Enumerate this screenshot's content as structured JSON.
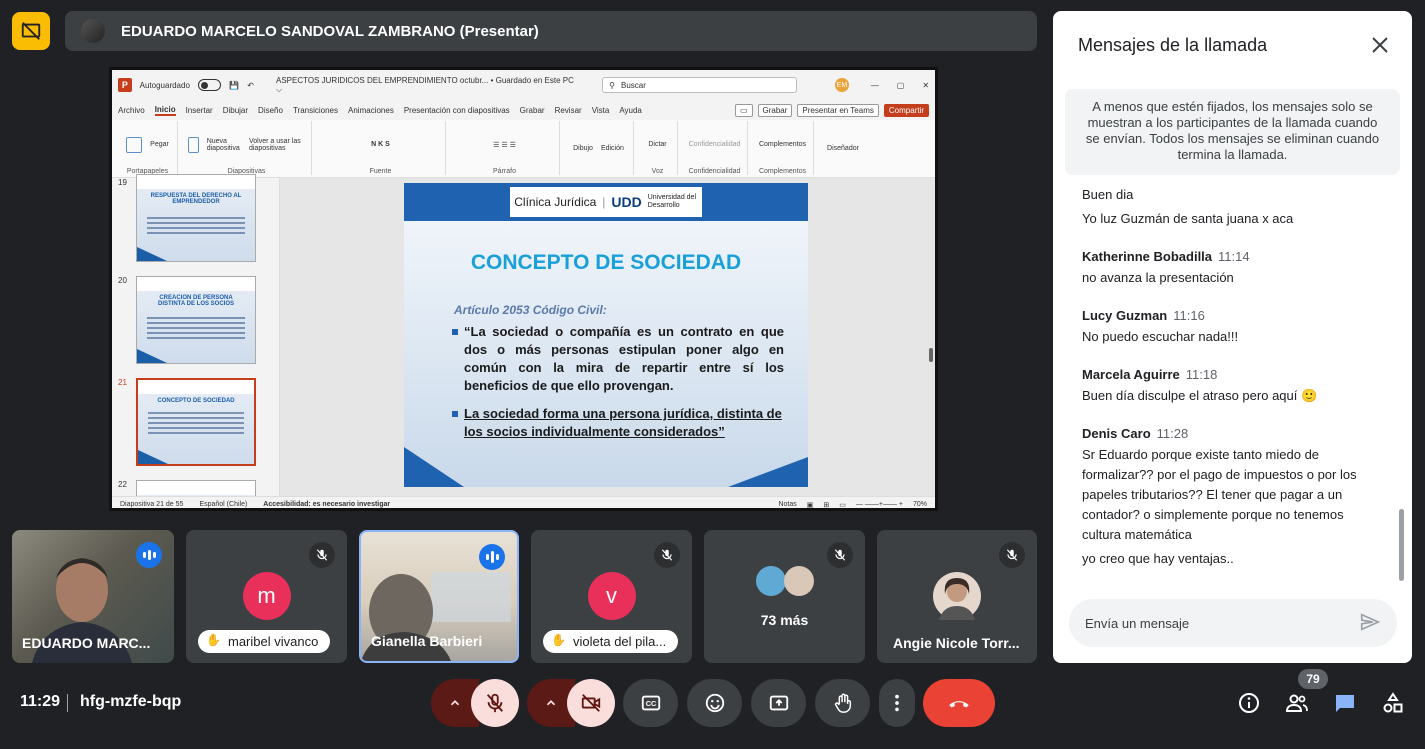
{
  "presenter": {
    "name": "EDUARDO MARCELO SANDOVAL ZAMBRANO (Presentar)"
  },
  "ppt": {
    "autosave_label": "Autoguardado",
    "doc_title": "ASPECTOS JURIDICOS DEL EMPRENDIMIENTO octubr...  •  Guardado en Este PC ⌵",
    "search_placeholder": "Buscar",
    "user_initials": "EM",
    "menu": [
      "Archivo",
      "Inicio",
      "Insertar",
      "Dibujar",
      "Diseño",
      "Transiciones",
      "Animaciones",
      "Presentación con diapositivas",
      "Grabar",
      "Revisar",
      "Vista",
      "Ayuda"
    ],
    "menu_right": [
      "Grabar",
      "Presentar en Teams",
      "Compartir"
    ],
    "ribbon_groups": [
      {
        "label": "Portapapeles",
        "items": [
          "Pegar"
        ]
      },
      {
        "label": "Diapositivas",
        "items": [
          "Nueva diapositiva",
          "Volver a usar las diapositivas"
        ]
      },
      {
        "label": "Fuente",
        "items": [
          "N K S"
        ]
      },
      {
        "label": "Párrafo",
        "items": [
          ""
        ]
      },
      {
        "label": "",
        "items": [
          "Dibujo",
          "Edición"
        ]
      },
      {
        "label": "Voz",
        "items": [
          "Dictar"
        ]
      },
      {
        "label": "Confidencialidad",
        "items": [
          "Confidencialidad"
        ]
      },
      {
        "label": "Complementos",
        "items": [
          "Complementos"
        ]
      },
      {
        "label": "",
        "items": [
          "Diseñador"
        ]
      }
    ],
    "thumbs": [
      {
        "num": "19",
        "title": "RESPUESTA DEL DERECHO AL EMPRENDEDOR"
      },
      {
        "num": "20",
        "title": "CREACION DE PERSONA DISTINTA DE LOS SOCIOS"
      },
      {
        "num": "21",
        "title": "CONCEPTO DE SOCIEDAD"
      },
      {
        "num": "22",
        "title": ""
      }
    ],
    "slide": {
      "logo_left": "Clínica Jurídica",
      "logo_right": "UDD",
      "logo_sub": "Universidad del Desarrollo",
      "title": "CONCEPTO DE SOCIEDAD",
      "article": "Artículo 2053 Código Civil:",
      "bullet1": "“La sociedad o compañía es un contrato en que dos o más personas estipulan poner algo en común con la mira de repartir entre sí los beneficios de que ello provengan.",
      "bullet2": "La sociedad forma una persona jurídica, distinta de los socios individualmente considerados”"
    },
    "status": {
      "slide_of": "Diapositiva 21 de 55",
      "language": "Español (Chile)",
      "accessibility": "Accesibilidad: es necesario investigar",
      "notes": "Notas",
      "zoom": "70%"
    }
  },
  "tiles": [
    {
      "name": "EDUARDO MARC...",
      "state": "speaking"
    },
    {
      "name": "maribel vivanco",
      "initial": "m",
      "color": "#e8305a",
      "state": "muted"
    },
    {
      "name": "Gianella Barbieri",
      "state": "speaking"
    },
    {
      "name": "violeta del pila...",
      "initial": "v",
      "color": "#e8305a",
      "state": "muted"
    },
    {
      "name": "73 más",
      "state": "muted"
    },
    {
      "name": "Angie Nicole Torr...",
      "state": "muted"
    }
  ],
  "meeting": {
    "time": "11:29",
    "code": "hfg-mzfe-bqp",
    "participants_count": "79"
  },
  "chat": {
    "title": "Mensajes de la llamada",
    "notice": "A menos que estén fijados, los mensajes solo se muestran a los participantes de la llamada cuando se envían. Todos los mensajes se eliminan cuando termina la llamada.",
    "top_lines": [
      "Buen dia",
      "Yo luz Guzmán de santa juana x aca"
    ],
    "messages": [
      {
        "sender": "Katherinne Bobadilla",
        "time": "11:14",
        "lines": [
          "no avanza la presentación"
        ]
      },
      {
        "sender": "Lucy Guzman",
        "time": "11:16",
        "lines": [
          "No puedo escuchar nada!!!"
        ]
      },
      {
        "sender": "Marcela Aguirre",
        "time": "11:18",
        "lines": [
          "Buen  día disculpe el atraso pero aquí 🙂"
        ]
      },
      {
        "sender": "Denis Caro",
        "time": "11:28",
        "lines": [
          "Sr Eduardo porque existe tanto miedo de formalizar?? por el pago de impuestos o por los papeles tributarios?? El tener que pagar a un contador? o simplemente porque no tenemos cultura matemática",
          "yo creo que hay ventajas.."
        ]
      }
    ],
    "input_placeholder": "Envía un mensaje"
  },
  "colors": {
    "background": "#202124",
    "tile": "#3c4043",
    "accent_blue": "#1a73e8",
    "end_call": "#ea4335",
    "present_badge": "#fbbc04"
  }
}
